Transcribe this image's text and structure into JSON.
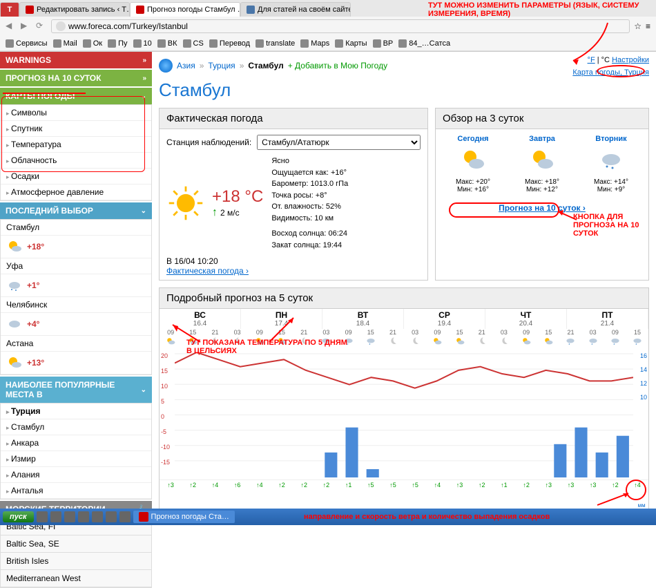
{
  "browser": {
    "tabs": [
      {
        "title": "Редактировать запись ‹ Т…",
        "active": false
      },
      {
        "title": "Прогноз погоды Стамбул …",
        "active": true
      },
      {
        "title": "Для статей на своём сайте",
        "active": false
      }
    ],
    "url": "www.foreca.com/Turkey/Istanbul",
    "bookmarks": [
      "Сервисы",
      "Mail",
      "Ок",
      "Пу",
      "10",
      "ВК",
      "CS",
      "Перевод",
      "translate",
      "Maps",
      "Карты",
      "BP",
      "84_…Сатса"
    ]
  },
  "annotations": {
    "top": "ТУТ МОЖНО ИЗМЕНИТЬ ПАРАМЕТРЫ (ЯЗЫК, СИСТЕМУ ИЗМЕРЕНИЯ, ВРЕМЯ)",
    "btn10": "КНОПКА ДЛЯ ПРОГНОЗА НА 10 СУТОК",
    "temp5": "ТУТ ПОКАЗАНА ТЕМПЕРАТУРА ПО 5 ДНЯМ В ЦЕЛЬСИЯХ",
    "wind": "направление и скорость ветра и количество выпадения осадков"
  },
  "sidebar": {
    "warnings": "WARNINGS",
    "tenDay": "ПРОГНОЗ НА 10 СУТОК",
    "maps": "КАРТЫ ПОГОДЫ",
    "mapItems": [
      "Символы",
      "Спутник",
      "Температура",
      "Облачность",
      "Осадки",
      "Атмосферное давление"
    ],
    "recent": "ПОСЛЕДНИЙ ВЫБОР",
    "recentCities": [
      {
        "name": "Стамбул",
        "temp": "+18°"
      },
      {
        "name": "Уфа",
        "temp": "+1°"
      },
      {
        "name": "Челябинск",
        "temp": "+4°"
      },
      {
        "name": "Астана",
        "temp": "+13°"
      }
    ],
    "popular": "НАИБОЛЕЕ ПОПУЛЯРНЫЕ МЕСТА В",
    "country": "Турция",
    "popularCities": [
      "Стамбул",
      "Анкара",
      "Измир",
      "Алания",
      "Анталья"
    ],
    "marine": "МОРСКИЕ ТЕРРИТОРИИ",
    "marineAreas": [
      "Baltic Sea, FI",
      "Baltic Sea, SE",
      "British Isles",
      "Mediterranean West"
    ]
  },
  "breadcrumb": {
    "asia": "Азия",
    "turkey": "Турция",
    "city": "Стамбул",
    "add": "+ Добавить в Мою Погоду"
  },
  "topright": {
    "f": "°F",
    "c": "°C",
    "settings": "Настройки"
  },
  "maplink": "Карта погоды, Турция",
  "cityTitle": "Стамбул",
  "current": {
    "head": "Фактическая погода",
    "stationLabel": "Станция наблюдений:",
    "station": "Стамбул/Ататюрк",
    "temp": "+18 °C",
    "wind": "2 м/с",
    "cond": "Ясно",
    "feels": "Ощущается как: +16°",
    "baro": "Барометр: 1013.0 гПа",
    "dew": "Точка росы: +8°",
    "hum": "От. влажность: 52%",
    "vis": "Видимость: 10 км",
    "sunrise": "Восход солнца: 06:24",
    "sunset": "Закат солнца: 19:44",
    "obsTime": "В 16/04 10:20",
    "obsLink": "Фактическая погода ›"
  },
  "overview": {
    "head": "Обзор на 3 суток",
    "days": [
      {
        "name": "Сегодня",
        "max": "Макс: +20°",
        "min": "Мин: +16°"
      },
      {
        "name": "Завтра",
        "max": "Макс: +18°",
        "min": "Мин: +12°"
      },
      {
        "name": "Вторник",
        "max": "Макс: +14°",
        "min": "Мин: +9°"
      }
    ],
    "link": "Прогноз на 10 суток ›"
  },
  "detail": {
    "head": "Подробный прогноз на 5 суток",
    "days": [
      {
        "dn": "ВС",
        "dt": "16.4"
      },
      {
        "dn": "ПН",
        "dt": "17.4"
      },
      {
        "dn": "ВТ",
        "dt": "18.4"
      },
      {
        "dn": "СР",
        "dt": "19.4"
      },
      {
        "dn": "ЧТ",
        "dt": "20.4"
      },
      {
        "dn": "ПТ",
        "dt": "21.4"
      }
    ],
    "hours": [
      "09",
      "15",
      "21",
      "03",
      "09",
      "15",
      "21",
      "03",
      "09",
      "15",
      "21",
      "03",
      "09",
      "15",
      "21",
      "03",
      "09",
      "15",
      "21",
      "03",
      "09",
      "15"
    ],
    "winds": [
      "3",
      "2",
      "4",
      "6",
      "4",
      "2",
      "2",
      "2",
      "1",
      "5",
      "5",
      "5",
      "4",
      "3",
      "2",
      "1",
      "2",
      "3",
      "3",
      "3",
      "2",
      "4"
    ],
    "unitL": "мм",
    "unitR": "м/с"
  },
  "chart_data": {
    "type": "line+bar",
    "title": "Подробный прогноз на 5 суток",
    "x_hours": [
      "09",
      "15",
      "21",
      "03",
      "09",
      "15",
      "21",
      "03",
      "09",
      "15",
      "21",
      "03",
      "09",
      "15",
      "21",
      "03",
      "09",
      "15",
      "21",
      "03",
      "09",
      "15"
    ],
    "temp_c": [
      17,
      20,
      18,
      16,
      17,
      18,
      15,
      13,
      11,
      13,
      12,
      10,
      12,
      15,
      16,
      14,
      13,
      15,
      14,
      12,
      12,
      13
    ],
    "precip_mm": [
      0,
      0,
      0,
      0,
      0,
      0,
      0,
      3,
      6,
      1,
      0,
      0,
      0,
      0,
      0,
      0,
      0,
      0,
      4,
      6,
      3,
      5
    ],
    "ylim_temp": [
      -15,
      20
    ],
    "ylim_precip": [
      10,
      16
    ],
    "wind_ms": [
      3,
      2,
      4,
      6,
      4,
      2,
      2,
      2,
      1,
      5,
      5,
      5,
      4,
      3,
      2,
      1,
      2,
      3,
      3,
      3,
      2,
      4
    ]
  },
  "taskbar": {
    "start": "пуск",
    "task": "Прогноз погоды Ста…"
  }
}
